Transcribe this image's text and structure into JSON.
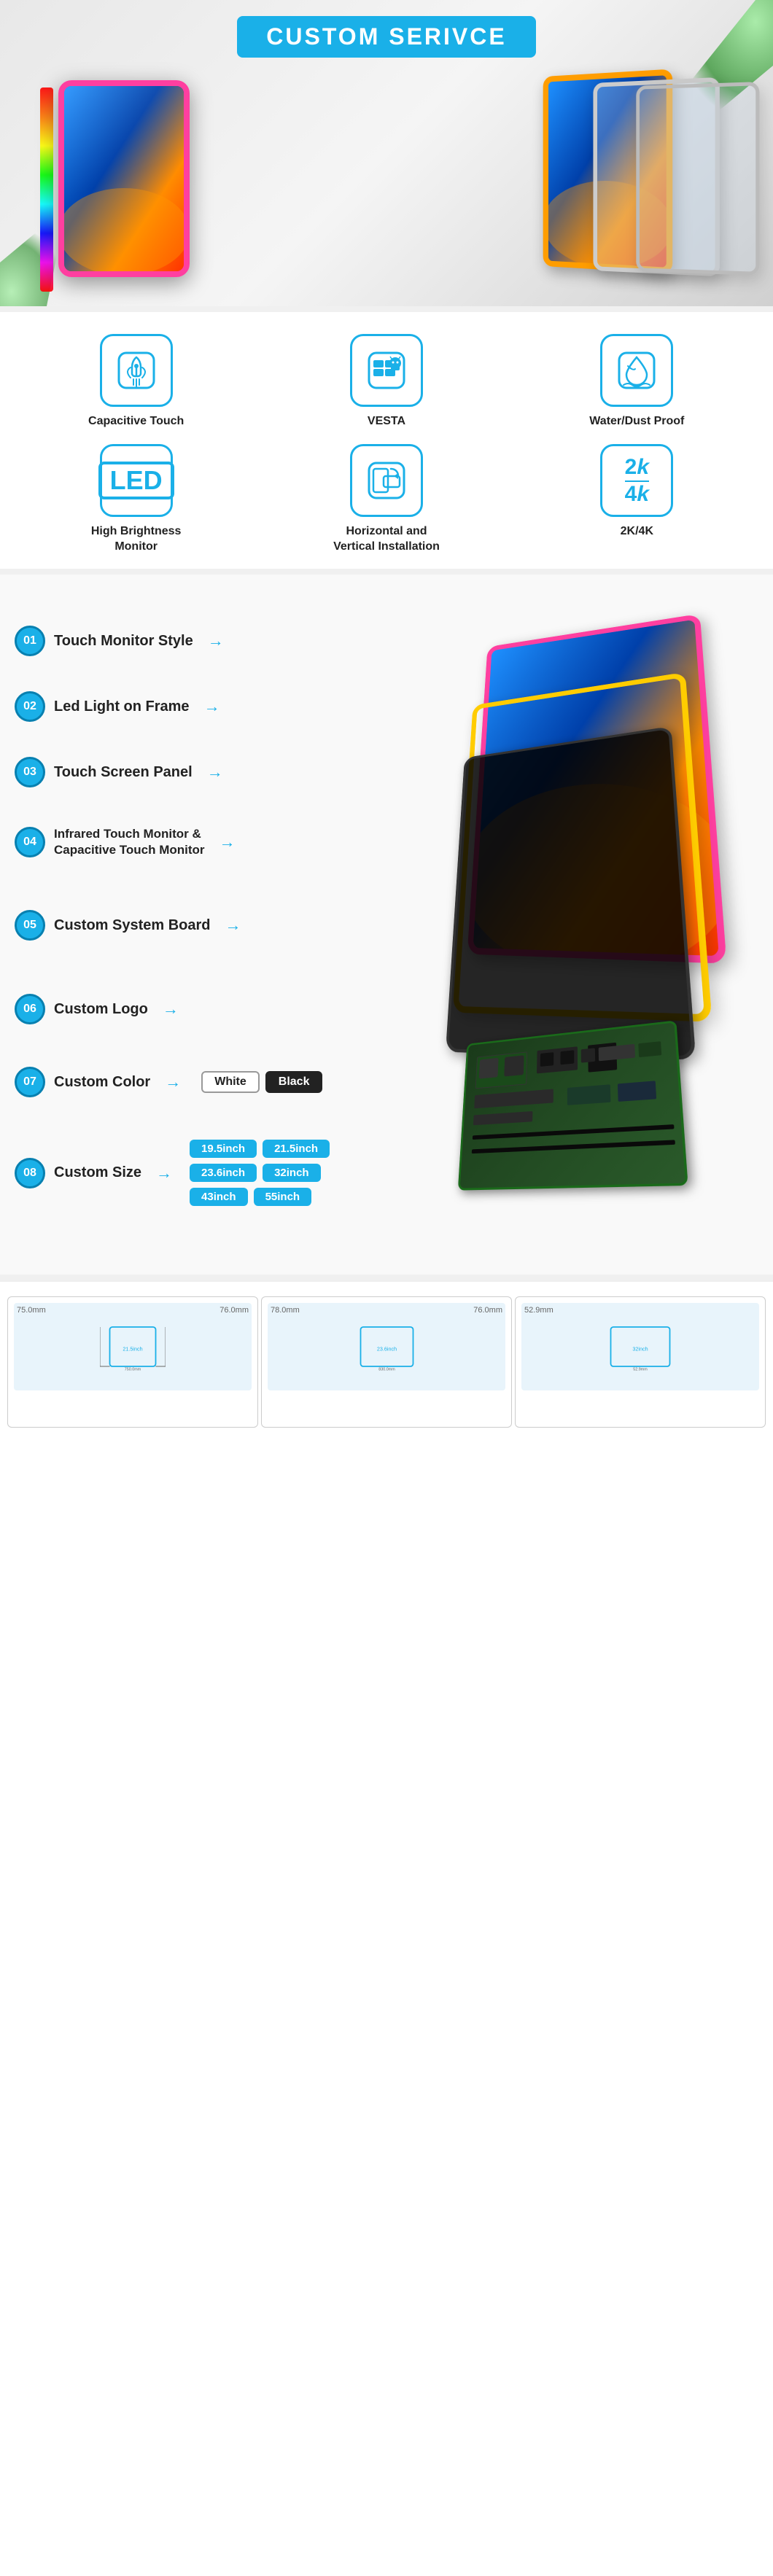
{
  "hero": {
    "title": "CUSTOM SERIVCE",
    "bg_color": "#e8e8e8"
  },
  "features": {
    "items": [
      {
        "id": "capacitive-touch",
        "icon_type": "touch",
        "label": "Capacitive Touch"
      },
      {
        "id": "vesta",
        "icon_type": "windows-android",
        "label": "VESTA"
      },
      {
        "id": "water-dust",
        "icon_type": "water-drop",
        "label": "Water/Dust Proof"
      },
      {
        "id": "led-monitor",
        "icon_type": "led",
        "label": "High Brightness\nMonitor"
      },
      {
        "id": "installation",
        "icon_type": "rotate",
        "label": "Horizontal and\nVertical Installation"
      },
      {
        "id": "resolution",
        "icon_type": "2k4k",
        "label": "2K/4K"
      }
    ]
  },
  "exploded": {
    "items": [
      {
        "number": "01",
        "label": "Touch Monitor Style"
      },
      {
        "number": "02",
        "label": "Led Light on Frame"
      },
      {
        "number": "03",
        "label": "Touch Screen Panel"
      },
      {
        "number": "04",
        "label": "Infrared Touch Monitor &\nCapacitive Touch Monitor"
      },
      {
        "number": "05",
        "label": "Custom System Board"
      },
      {
        "number": "06",
        "label": "Custom Logo"
      },
      {
        "number": "07",
        "label": "Custom Color"
      },
      {
        "number": "08",
        "label": "Custom Size"
      }
    ],
    "color_options": [
      "White",
      "Black"
    ],
    "size_options": [
      "19.5inch",
      "21.5inch",
      "23.6inch",
      "32inch",
      "43inch",
      "55inch"
    ]
  },
  "accent_color": "#1ab0e8"
}
